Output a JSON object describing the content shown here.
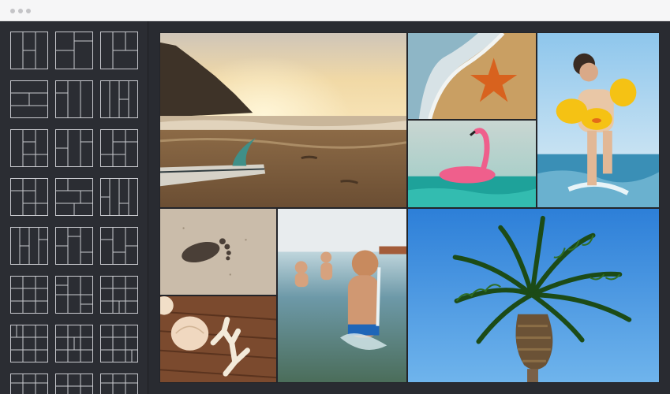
{
  "window": {
    "controls": [
      "dot",
      "dot",
      "dot"
    ]
  },
  "sidebar": {
    "templates": [
      "layout-template-1",
      "layout-template-2",
      "layout-template-3",
      "layout-template-4",
      "layout-template-5",
      "layout-template-6",
      "layout-template-7",
      "layout-template-8",
      "layout-template-9",
      "layout-template-10",
      "layout-template-11",
      "layout-template-12",
      "layout-template-13",
      "layout-template-14",
      "layout-template-15",
      "layout-template-16",
      "layout-template-17",
      "layout-template-18",
      "layout-template-19",
      "layout-template-20",
      "layout-template-21",
      "layout-template-22",
      "layout-template-23",
      "layout-template-24"
    ]
  },
  "collage": {
    "photos": [
      "beach-sunset-surfboard-photo",
      "starfish-on-sand-photo",
      "girl-with-duck-floaties-photo",
      "pink-flamingo-float-photo",
      "footprint-in-sand-photo",
      "seashells-on-wood-photo",
      "boys-splashing-in-sea-photo",
      "palm-tree-blue-sky-photo"
    ]
  },
  "colors": {
    "window_bg": "#2a2c32",
    "titlebar_bg": "#f6f6f7",
    "template_stroke": "#c9cacf"
  }
}
